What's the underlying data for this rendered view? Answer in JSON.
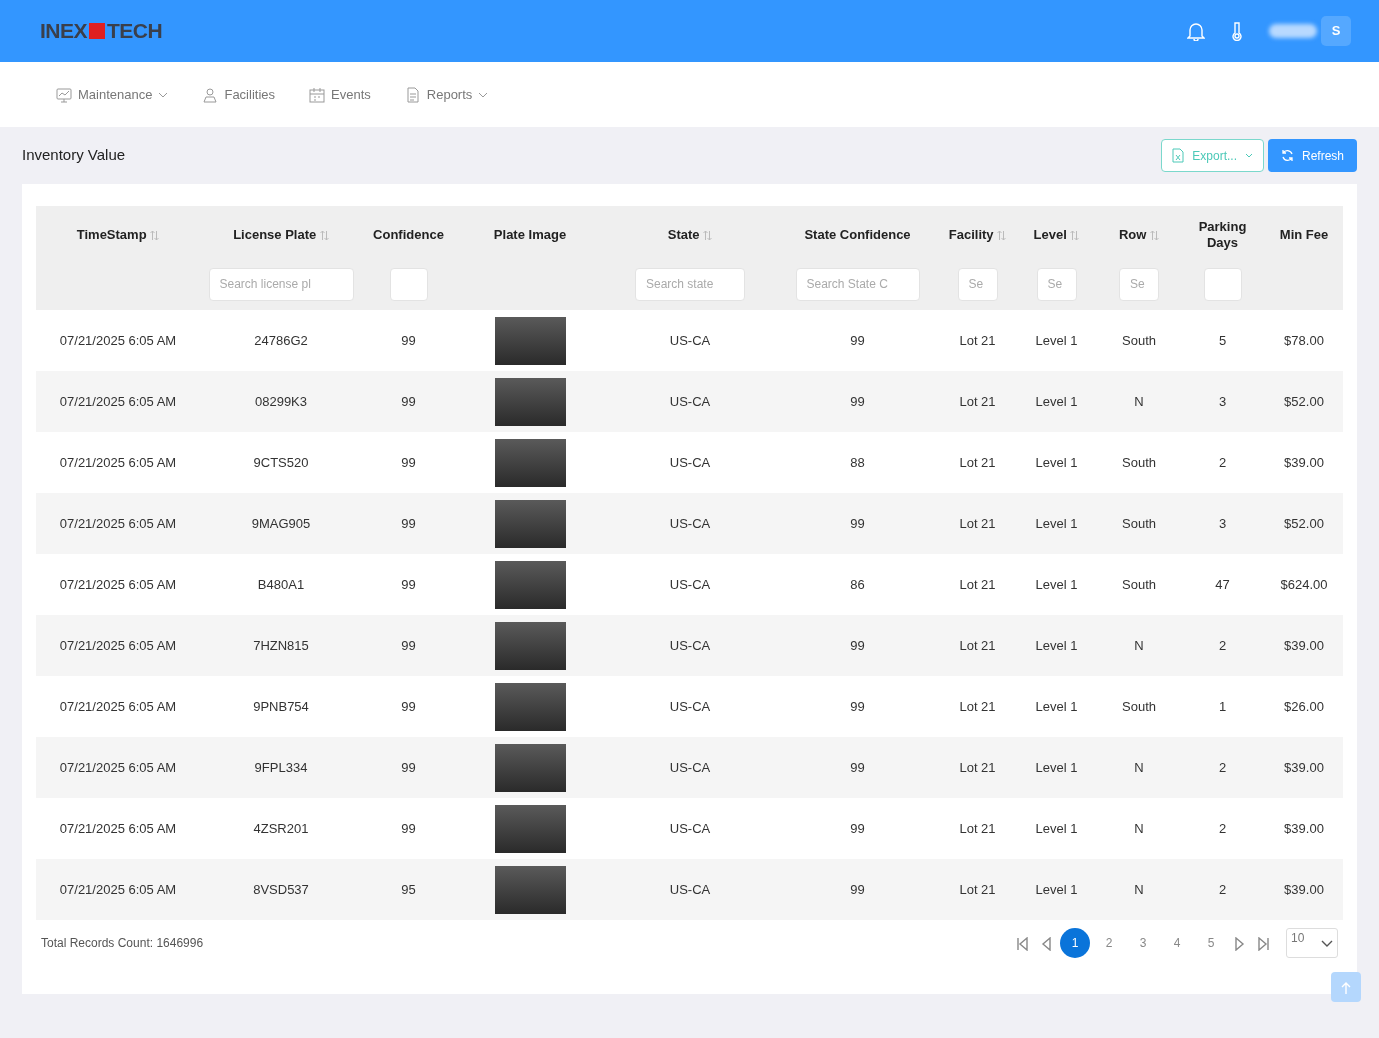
{
  "header": {
    "logo": {
      "left": "INEX",
      "right": "TECH"
    },
    "avatar": "S"
  },
  "nav": [
    {
      "label": "Maintenance",
      "dropdown": true
    },
    {
      "label": "Facilities",
      "dropdown": false
    },
    {
      "label": "Events",
      "dropdown": false
    },
    {
      "label": "Reports",
      "dropdown": true
    }
  ],
  "page_title": "Inventory Value",
  "actions": [
    {
      "label": "Export...",
      "kind": "export"
    },
    {
      "label": "Refresh",
      "kind": "refresh"
    }
  ],
  "table": {
    "columns": [
      {
        "label": "TimeStamp",
        "kind": "text",
        "sortable": true,
        "has_filter": false
      },
      {
        "label": "License Plate",
        "kind": "text",
        "sortable": true,
        "has_filter": true,
        "placeholder": "Search license pl"
      },
      {
        "label": "Confidence",
        "kind": "text",
        "sortable": false,
        "has_filter": true
      },
      {
        "label": "Plate Image",
        "kind": "image",
        "sortable": false,
        "has_filter": false
      },
      {
        "label": "State",
        "kind": "text",
        "sortable": true,
        "has_filter": true,
        "placeholder": "Search state"
      },
      {
        "label": "State Confidence",
        "kind": "text",
        "sortable": false,
        "has_filter": true,
        "placeholder": "Search State C"
      },
      {
        "label": "Facility",
        "kind": "text",
        "sortable": true,
        "has_filter": true,
        "placeholder": "Se"
      },
      {
        "label": "Level",
        "kind": "text",
        "sortable": true,
        "has_filter": true,
        "placeholder": "Se"
      },
      {
        "label": "Row",
        "kind": "text",
        "sortable": true,
        "has_filter": true,
        "placeholder": "Se"
      },
      {
        "label": "Parking Days",
        "kind": "text",
        "sortable": false,
        "has_filter": true
      },
      {
        "label": "Min Fee",
        "kind": "text",
        "sortable": false,
        "has_filter": false
      }
    ],
    "rows": [
      {
        "cells": [
          "07/21/2025 6:05 AM",
          "24786G2",
          "99",
          "",
          "US-CA",
          "99",
          "Lot 21",
          "Level 1",
          "South",
          "5",
          "$78.00"
        ]
      },
      {
        "cells": [
          "07/21/2025 6:05 AM",
          "08299K3",
          "99",
          "",
          "US-CA",
          "99",
          "Lot 21",
          "Level 1",
          "N",
          "3",
          "$52.00"
        ]
      },
      {
        "cells": [
          "07/21/2025 6:05 AM",
          "9CTS520",
          "99",
          "",
          "US-CA",
          "88",
          "Lot 21",
          "Level 1",
          "South",
          "2",
          "$39.00"
        ]
      },
      {
        "cells": [
          "07/21/2025 6:05 AM",
          "9MAG905",
          "99",
          "",
          "US-CA",
          "99",
          "Lot 21",
          "Level 1",
          "South",
          "3",
          "$52.00"
        ]
      },
      {
        "cells": [
          "07/21/2025 6:05 AM",
          "B480A1",
          "99",
          "",
          "US-CA",
          "86",
          "Lot 21",
          "Level 1",
          "South",
          "47",
          "$624.00"
        ]
      },
      {
        "cells": [
          "07/21/2025 6:05 AM",
          "7HZN815",
          "99",
          "",
          "US-CA",
          "99",
          "Lot 21",
          "Level 1",
          "N",
          "2",
          "$39.00"
        ]
      },
      {
        "cells": [
          "07/21/2025 6:05 AM",
          "9PNB754",
          "99",
          "",
          "US-CA",
          "99",
          "Lot 21",
          "Level 1",
          "South",
          "1",
          "$26.00"
        ]
      },
      {
        "cells": [
          "07/21/2025 6:05 AM",
          "9FPL334",
          "99",
          "",
          "US-CA",
          "99",
          "Lot 21",
          "Level 1",
          "N",
          "2",
          "$39.00"
        ]
      },
      {
        "cells": [
          "07/21/2025 6:05 AM",
          "4ZSR201",
          "99",
          "",
          "US-CA",
          "99",
          "Lot 21",
          "Level 1",
          "N",
          "2",
          "$39.00"
        ]
      },
      {
        "cells": [
          "07/21/2025 6:05 AM",
          "8VSD537",
          "95",
          "",
          "US-CA",
          "99",
          "Lot 21",
          "Level 1",
          "N",
          "2",
          "$39.00"
        ]
      }
    ]
  },
  "footer": {
    "total": "Total Records Count: 1646996",
    "pages": [
      {
        "label": "1",
        "selected": true
      },
      {
        "label": "2",
        "selected": false
      },
      {
        "label": "3",
        "selected": false
      },
      {
        "label": "4",
        "selected": false
      },
      {
        "label": "5",
        "selected": false
      }
    ],
    "page_size": "10"
  }
}
